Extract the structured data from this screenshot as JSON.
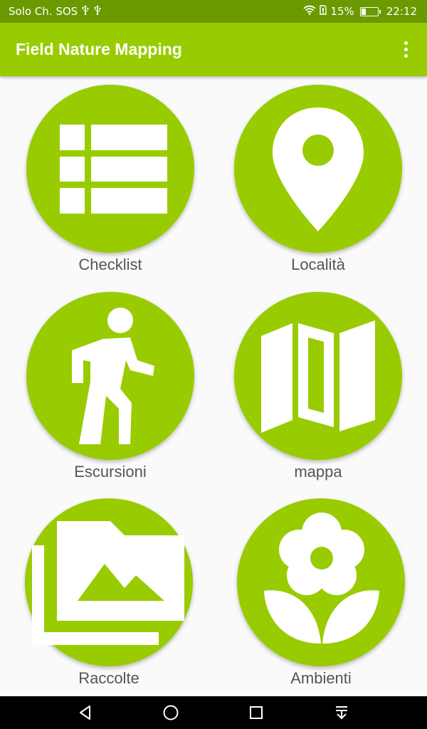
{
  "status_bar": {
    "carrier": "Solo Ch. SOS",
    "usb_icons": [
      "usb-icon",
      "usb-icon"
    ],
    "battery_percent": "15%",
    "time": "22:12",
    "icons": [
      "wifi-icon",
      "sim-icon",
      "battery-icon"
    ]
  },
  "app_bar": {
    "title": "Field Nature Mapping",
    "overflow_icon": "more-vert-icon"
  },
  "tiles": [
    {
      "label": "Checklist",
      "icon": "list-icon"
    },
    {
      "label": "Località",
      "icon": "location-pin-icon"
    },
    {
      "label": "Escursioni",
      "icon": "hiker-icon"
    },
    {
      "label": "mappa",
      "icon": "map-icon"
    },
    {
      "label": "Raccolte",
      "icon": "photo-folder-icon"
    },
    {
      "label": "Ambienti",
      "icon": "flower-icon"
    }
  ],
  "nav_bar": {
    "items": [
      "back-icon",
      "home-icon",
      "recents-icon",
      "notifications-pull-icon"
    ]
  },
  "colors": {
    "accent": "#99cc00",
    "status_bar": "#6a9a00",
    "label_text": "#555555",
    "background": "#fafafa"
  }
}
